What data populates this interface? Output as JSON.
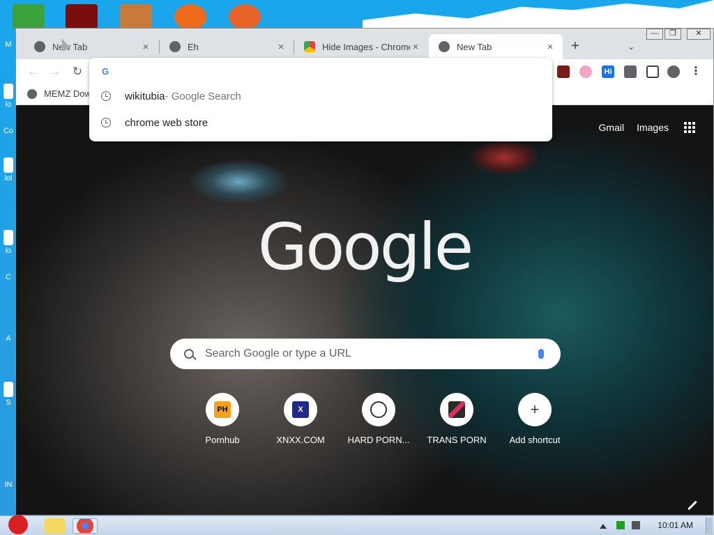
{
  "window": {
    "tabs": [
      {
        "title": "New Tab",
        "close": "×"
      },
      {
        "title": "Eh",
        "close": "×"
      },
      {
        "title": "Hide Images - Chrome",
        "close": "×"
      },
      {
        "title": "New Tab",
        "close": "×"
      }
    ],
    "new_tab": "+",
    "tab_search": "⌄",
    "controls": {
      "minimize": "—",
      "restore": "❐",
      "close": "✕"
    }
  },
  "toolbar": {
    "back": "←",
    "forward": "→",
    "reload": "↻",
    "omnibox_value": "",
    "extensions": [
      "uBlock",
      "badge",
      "Hi",
      "puzzle",
      "sidepanel",
      "profile",
      "menu"
    ]
  },
  "bookmarks": [
    {
      "label": "MEMZ Dow"
    }
  ],
  "omnibox_suggestions": {
    "engine_icon": "G",
    "items": [
      {
        "text": "wikitubia",
        "hint": " - Google Search"
      },
      {
        "text": "chrome web store",
        "hint": ""
      }
    ]
  },
  "ntp": {
    "links": {
      "gmail": "Gmail",
      "images": "Images"
    },
    "logo": "Google",
    "search_placeholder": "Search Google or type a URL",
    "shortcuts": [
      {
        "label": "Pornhub",
        "icon_text": "PH",
        "icon_bg": "#f7a11a",
        "icon_fg": "#000000"
      },
      {
        "label": "XNXX.COM",
        "icon_text": "X",
        "icon_bg": "#1f2a8a",
        "icon_fg": "#ffffff"
      },
      {
        "label": "HARD PORN...",
        "icon_text": "🐼",
        "icon_bg": "#ffffff",
        "icon_fg": "#000000"
      },
      {
        "label": "TRANS PORN",
        "icon_text": "",
        "icon_bg": "#b0305a",
        "icon_fg": "#ffffff"
      },
      {
        "label": "Add shortcut",
        "icon_text": "+",
        "icon_bg": "#ffffff",
        "icon_fg": "#3c4043"
      }
    ]
  },
  "desktop": {
    "side_labels": [
      "M",
      "lo",
      "Co",
      "lol",
      "lo",
      "C",
      "A",
      "S",
      "IN"
    ]
  },
  "taskbar": {
    "clock": "10:01 AM"
  },
  "colors": {
    "accent": "#4285f4",
    "tab_strip": "#dee1e6",
    "desktop": "#1aa6ec"
  }
}
